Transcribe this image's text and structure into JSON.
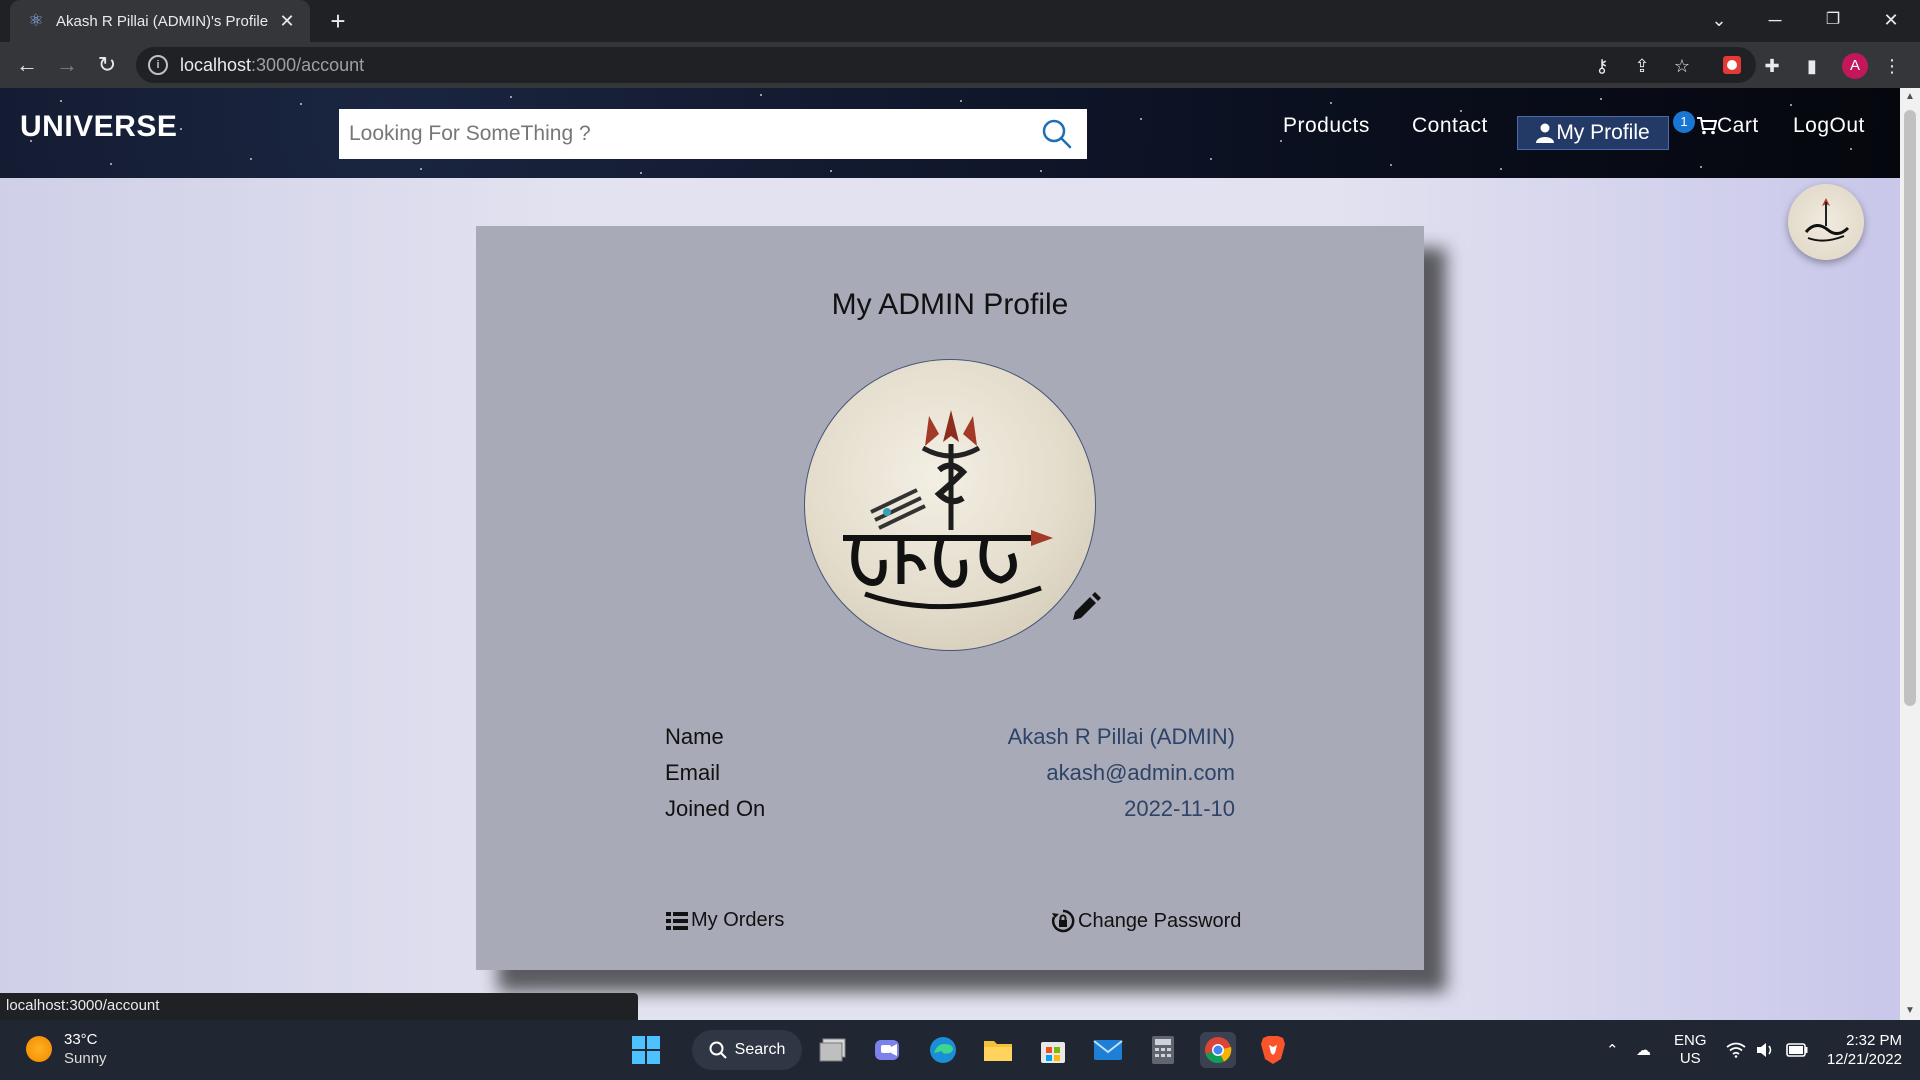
{
  "browser": {
    "tab_title": "Akash R Pillai (ADMIN)'s Profile",
    "url_host": "localhost",
    "url_path": ":3000/account",
    "profile_initial": "A"
  },
  "header": {
    "logo": "UNIVERSE",
    "search_placeholder": "Looking For SomeThing ?",
    "nav": {
      "products": "Products",
      "contact": "Contact",
      "my_profile": "My Profile",
      "cart": "Cart",
      "cart_count": "1",
      "logout": "LogOut"
    }
  },
  "card": {
    "title": "My ADMIN Profile",
    "fields": [
      {
        "label": "Name",
        "value": "Akash R Pillai (ADMIN)"
      },
      {
        "label": "Email",
        "value": "akash@admin.com"
      },
      {
        "label": "Joined On",
        "value": "2022-11-10"
      }
    ],
    "actions": {
      "orders": "My Orders",
      "change_password": "Change Password"
    },
    "avatar_caption": "महादेव"
  },
  "status_bar": {
    "url": "localhost:3000/account"
  },
  "taskbar": {
    "weather_temp": "33°C",
    "weather_desc": "Sunny",
    "search_label": "Search",
    "lang_top": "ENG",
    "lang_bottom": "US",
    "time": "2:32 PM",
    "date": "12/21/2022"
  },
  "colors": {
    "card_bg": "#a9aab7",
    "value_text": "#2d4468",
    "profile_btn_bg": "#243a66",
    "badge": "#1976d2"
  }
}
